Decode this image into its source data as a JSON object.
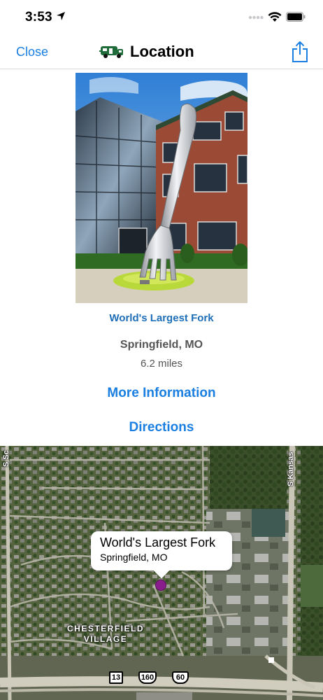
{
  "status_bar": {
    "time": "3:53",
    "icons": [
      "location-arrow-icon",
      "cellular-signal-icon",
      "wifi-icon",
      "battery-icon"
    ]
  },
  "nav": {
    "close_label": "Close",
    "title": "Location",
    "title_icon": "rv-camper-icon",
    "share_icon": "share-icon",
    "accent_color": "#1a7fe0"
  },
  "place": {
    "photo_alt": "World's Largest Fork",
    "name": "World's Largest Fork",
    "city": "Springfield, MO",
    "distance": "6.2 miles",
    "name_color": "#1e6fb8"
  },
  "actions": {
    "more_info_label": "More Information",
    "directions_label": "Directions"
  },
  "map": {
    "road_labels": [
      "S Sc",
      "S Kansas"
    ],
    "area_label_line1": "CHESTERFIELD",
    "area_label_line2": "VILLAGE",
    "callout_title": "World's Largest Fork",
    "callout_subtitle": "Springfield, MO",
    "route_shields": [
      "13",
      "160",
      "60"
    ],
    "pin_color": "#8a1d8c"
  }
}
